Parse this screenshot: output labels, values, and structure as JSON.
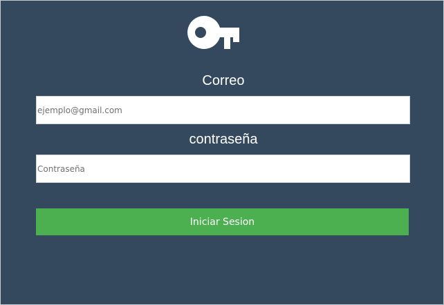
{
  "form": {
    "icon": "key-icon",
    "email_label": "Correo",
    "email_placeholder": "ejemplo@gmail.com",
    "email_value": "",
    "password_label": "contraseña",
    "password_placeholder": "Contraseña",
    "password_value": "",
    "submit_label": "Iniciar Sesion"
  },
  "colors": {
    "background": "#34495e",
    "button": "#4caf50",
    "text": "#ffffff"
  }
}
